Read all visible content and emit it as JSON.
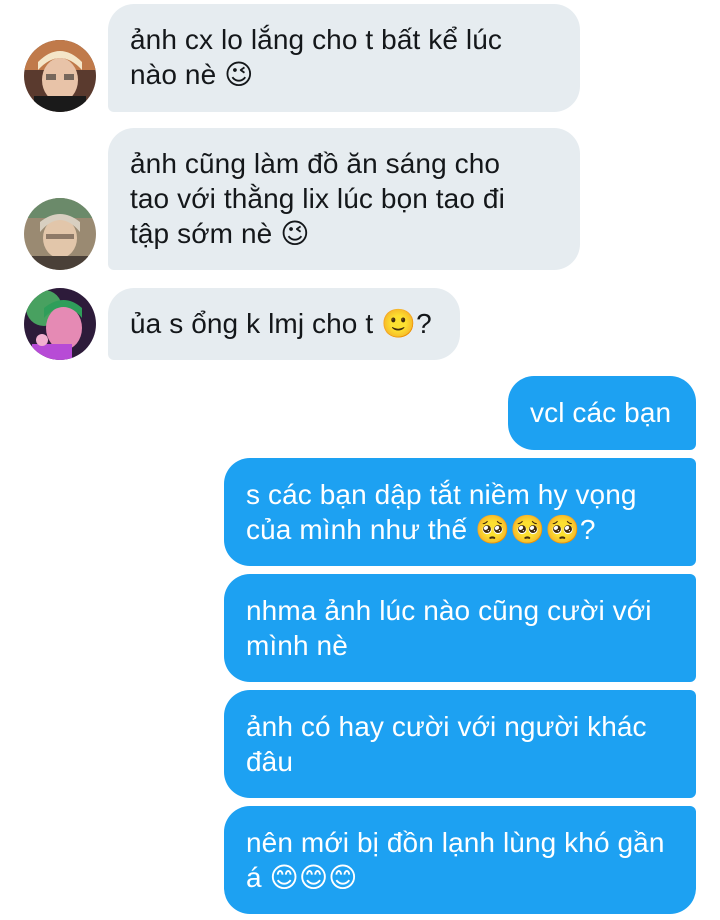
{
  "messages": [
    {
      "direction": "in",
      "text": "ảnh cx lo lắng cho t bất kể lúc\nnào nè 😉",
      "avatar": "avatar-1"
    },
    {
      "direction": "in",
      "text": "ảnh cũng làm đồ ăn sáng cho\ntao với thằng lix lúc bọn tao đi\ntập sớm nè 😉",
      "avatar": "avatar-2"
    },
    {
      "direction": "in",
      "text": "ủa s ổng k lmj cho t 🙂?",
      "avatar": "avatar-3"
    },
    {
      "direction": "out",
      "text": "vcl các bạn"
    },
    {
      "direction": "out",
      "text": "s các bạn dập tắt niềm hy vọng\ncủa mình như thế 🥺🥺🥺?"
    },
    {
      "direction": "out",
      "text": "nhma ảnh lúc nào cũng cười với\nmình nè"
    },
    {
      "direction": "out",
      "text": "ảnh có hay cười với người khác\nđâu"
    },
    {
      "direction": "out",
      "text": "nên mới bị đồn lạnh lùng khó gần\ná 😊😊😊"
    }
  ],
  "colors": {
    "incoming_bubble": "#e6ecf0",
    "incoming_text": "#14171a",
    "outgoing_bubble": "#1da1f2",
    "outgoing_text": "#ffffff"
  }
}
